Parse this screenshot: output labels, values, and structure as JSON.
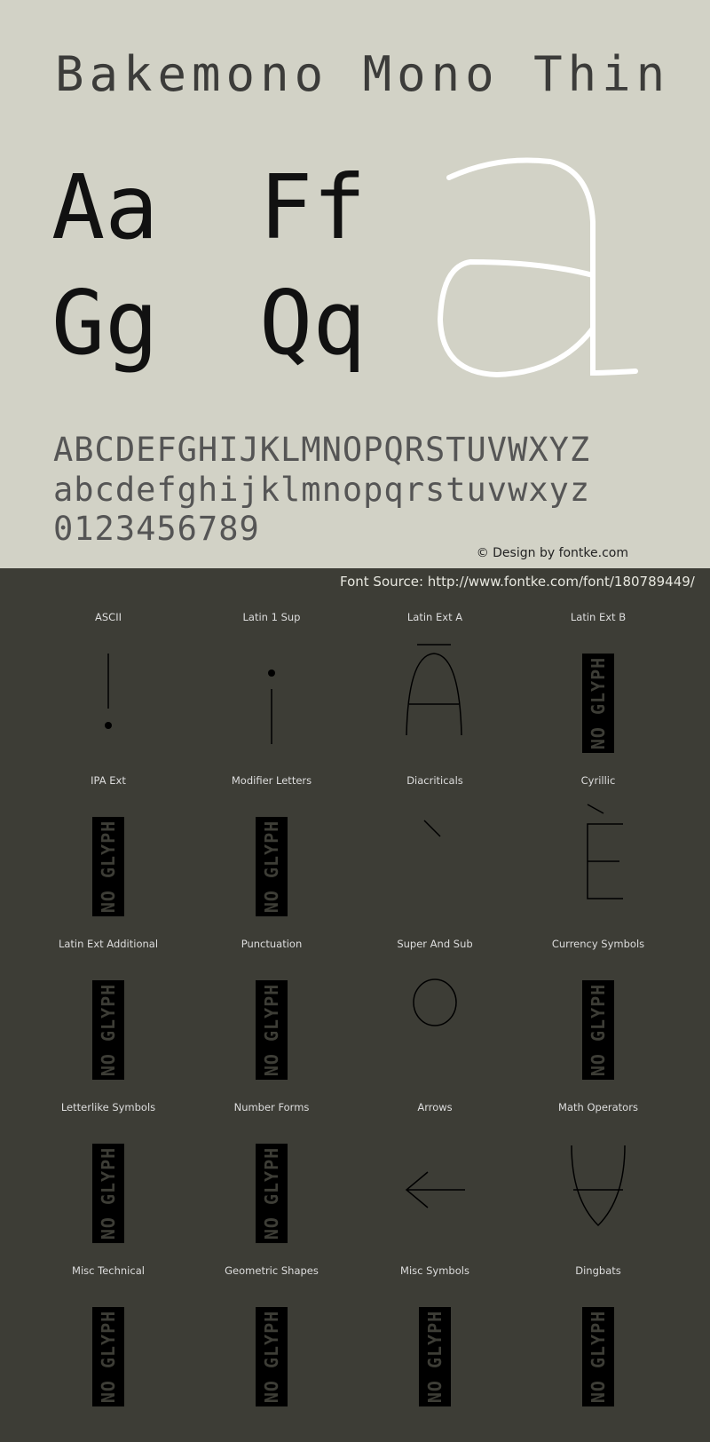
{
  "title": "Bakemono Mono Thin",
  "samples": [
    "Aa",
    "Ff",
    "Gg",
    "Qq"
  ],
  "big_glyph": "a",
  "uppercase": "ABCDEFGHIJKLMNOPQRSTUVWXYZ",
  "lowercase": "abcdefghijklmnopqrstuvwxyz",
  "digits": "0123456789",
  "credit": "© Design by fontke.com",
  "source": "Font Source: http://www.fontke.com/font/180789449/",
  "no_glyph_text": "NO GLYPH",
  "blocks": [
    {
      "label": "ASCII",
      "glyph": "exclam"
    },
    {
      "label": "Latin 1 Sup",
      "glyph": "exclamdown"
    },
    {
      "label": "Latin Ext A",
      "glyph": "Amacron"
    },
    {
      "label": "Latin Ext B",
      "glyph": "none"
    },
    {
      "label": "IPA Ext",
      "glyph": "none"
    },
    {
      "label": "Modifier Letters",
      "glyph": "none"
    },
    {
      "label": "Diacriticals",
      "glyph": "grave"
    },
    {
      "label": "Cyrillic",
      "glyph": "Egrave"
    },
    {
      "label": "Latin Ext Additional",
      "glyph": "none"
    },
    {
      "label": "Punctuation",
      "glyph": "none"
    },
    {
      "label": "Super And Sub",
      "glyph": "zerosuperior"
    },
    {
      "label": "Currency Symbols",
      "glyph": "none"
    },
    {
      "label": "Letterlike Symbols",
      "glyph": "none"
    },
    {
      "label": "Number Forms",
      "glyph": "none"
    },
    {
      "label": "Arrows",
      "glyph": "arrowleft"
    },
    {
      "label": "Math Operators",
      "glyph": "union-like"
    },
    {
      "label": "Misc Technical",
      "glyph": "none"
    },
    {
      "label": "Geometric Shapes",
      "glyph": "none"
    },
    {
      "label": "Misc Symbols",
      "glyph": "none"
    },
    {
      "label": "Dingbats",
      "glyph": "none"
    }
  ]
}
